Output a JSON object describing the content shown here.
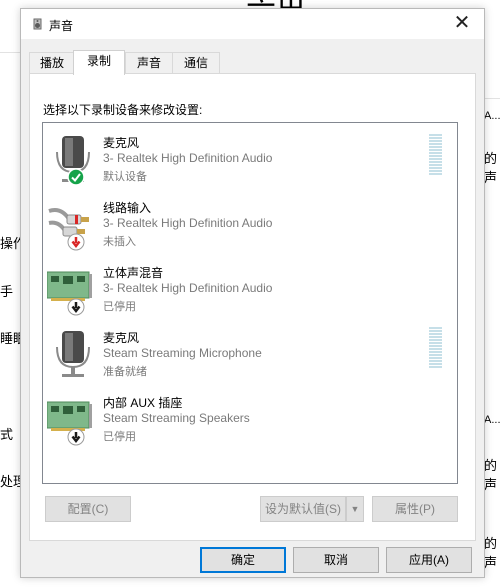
{
  "background": {
    "top_glyph": "六出",
    "left_texts": [
      "操作",
      "手",
      "睡眠",
      "式",
      "处理"
    ],
    "right_texts": [
      "A...",
      "的声",
      "A...",
      "的声",
      "的声"
    ]
  },
  "dialog": {
    "title": "声音",
    "close_glyph": "✕",
    "tabs": [
      {
        "label": "播放",
        "active": false
      },
      {
        "label": "录制",
        "active": true
      },
      {
        "label": "声音",
        "active": false
      },
      {
        "label": "通信",
        "active": false
      }
    ],
    "prompt": "选择以下录制设备来修改设置:",
    "devices": [
      {
        "name": "麦克风",
        "description": "3- Realtek High Definition Audio",
        "status": "默认设备",
        "icon": "microphone-icon",
        "badge": "default-check-badge",
        "meter": true
      },
      {
        "name": "线路输入",
        "description": "3- Realtek High Definition Audio",
        "status": "未插入",
        "icon": "line-in-icon",
        "badge": "unplugged-badge",
        "meter": false
      },
      {
        "name": "立体声混音",
        "description": "3- Realtek High Definition Audio",
        "status": "已停用",
        "icon": "sound-card-icon",
        "badge": "disabled-badge",
        "meter": false
      },
      {
        "name": "麦克风",
        "description": "Steam Streaming Microphone",
        "status": "准备就绪",
        "icon": "microphone-icon",
        "badge": "none",
        "meter": true
      },
      {
        "name": "内部 AUX 插座",
        "description": "Steam Streaming Speakers",
        "status": "已停用",
        "icon": "sound-card-icon",
        "badge": "disabled-badge",
        "meter": false
      }
    ],
    "buttons": {
      "configure": "配置(C)",
      "set_default": "设为默认值(S)",
      "properties": "属性(P)",
      "ok": "确定",
      "cancel": "取消",
      "apply": "应用(A)"
    },
    "colors": {
      "accent": "#0078d7",
      "check_green": "#16a34a",
      "unplug_red": "#d92626"
    }
  }
}
